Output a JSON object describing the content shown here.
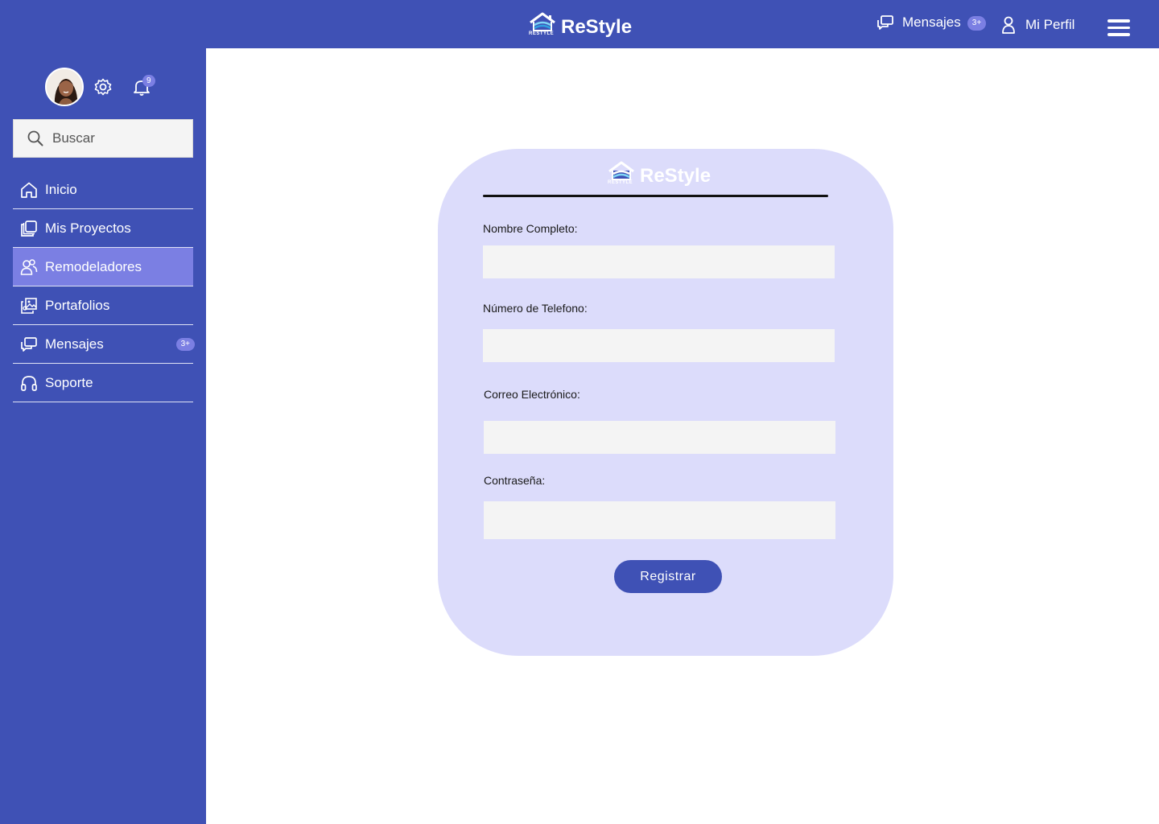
{
  "header": {
    "brand_name": "ReStyle",
    "brand_small": "RESTYLE",
    "messages_label": "Mensajes",
    "messages_badge": "3+",
    "profile_label": "Mi Perfil"
  },
  "sidebar": {
    "notifications_count": "9",
    "search_placeholder": "Buscar",
    "items": [
      {
        "label": "Inicio",
        "icon": "home-icon",
        "active": false
      },
      {
        "label": "Mis Proyectos",
        "icon": "projects-icon",
        "active": false
      },
      {
        "label": "Remodeladores",
        "icon": "users-icon",
        "active": true
      },
      {
        "label": "Portafolios",
        "icon": "portfolio-icon",
        "active": false
      },
      {
        "label": "Mensajes",
        "icon": "messages-icon",
        "active": false,
        "badge": "3+"
      },
      {
        "label": "Soporte",
        "icon": "headset-icon",
        "active": false
      }
    ]
  },
  "form": {
    "brand_name": "ReStyle",
    "brand_small": "RESTYLE",
    "fields": [
      {
        "label": "Nombre Completo:",
        "value": ""
      },
      {
        "label": "Número de Telefono:",
        "value": ""
      },
      {
        "label": "Correo Electrónico:",
        "value": ""
      },
      {
        "label": "Contraseña:",
        "value": ""
      }
    ],
    "submit_label": "Registrar"
  },
  "colors": {
    "primary": "#3f51b5",
    "accent": "#7b7fe3",
    "card": "#dcdcfb",
    "input": "#f4f4f4"
  }
}
